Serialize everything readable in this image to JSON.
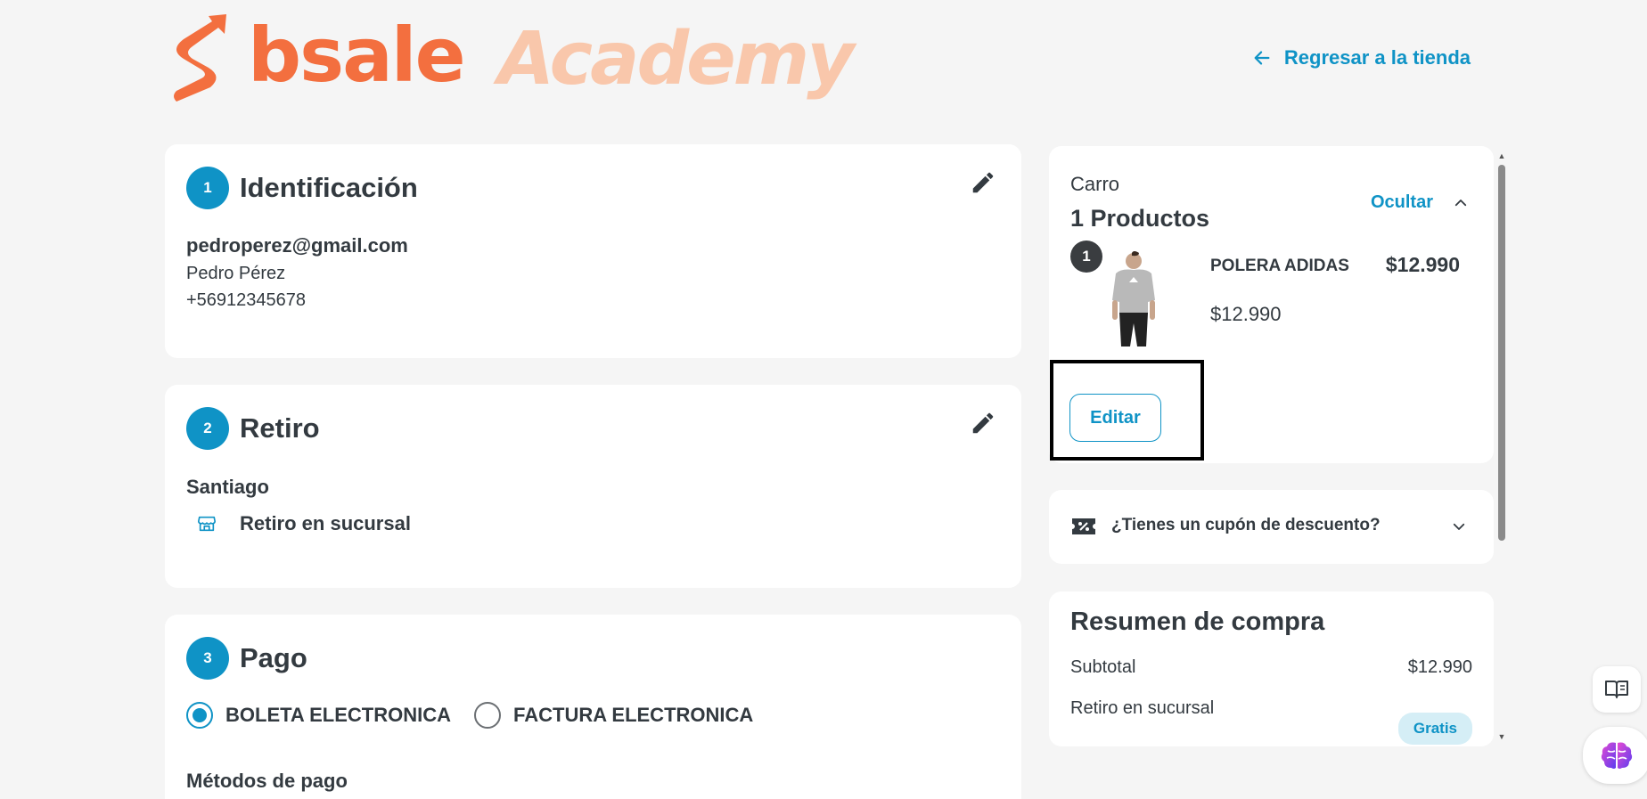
{
  "header": {
    "brand": "bsale",
    "academy": "Academy",
    "back_link": "Regresar a la tienda"
  },
  "identification": {
    "step": "1",
    "title": "Identificación",
    "email": "pedroperez@gmail.com",
    "name": "Pedro Pérez",
    "phone": "+56912345678"
  },
  "pickup": {
    "step": "2",
    "title": "Retiro",
    "city": "Santiago",
    "method": "Retiro en sucursal"
  },
  "payment": {
    "step": "3",
    "title": "Pago",
    "options": [
      "BOLETA ELECTRONICA",
      "FACTURA ELECTRONICA"
    ],
    "selected": "BOLETA ELECTRONICA",
    "methods_label": "Métodos de pago"
  },
  "cart": {
    "label": "Carro",
    "count": "1 Productos",
    "toggle": "Ocultar",
    "item": {
      "qty": "1",
      "name": "POLERA ADIDAS",
      "total": "$12.990",
      "unit_price": "$12.990"
    },
    "edit": "Editar"
  },
  "coupon": {
    "text": "¿Tienes un cupón de descuento?"
  },
  "summary": {
    "title": "Resumen de compra",
    "subtotal_label": "Subtotal",
    "subtotal_value": "$12.990",
    "shipping_label": "Retiro en sucursal",
    "shipping_value": "Gratis"
  },
  "colors": {
    "accent": "#0f93c6",
    "brand_orange": "#f36f3f",
    "academy_peach": "#f9c7ab"
  }
}
